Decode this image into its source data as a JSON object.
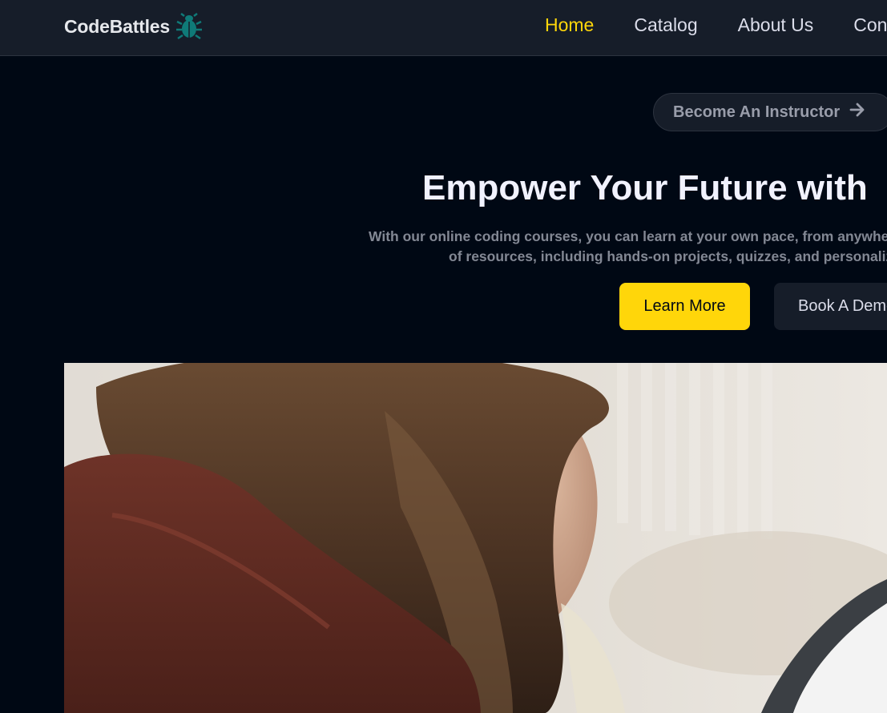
{
  "navbar": {
    "logo_text": "CodeBattles",
    "logo_icon": "bug-icon",
    "links": [
      {
        "label": "Home",
        "active": true
      },
      {
        "label": "Catalog",
        "active": false
      },
      {
        "label": "About Us",
        "active": false
      },
      {
        "label": "Cont",
        "active": false
      }
    ]
  },
  "hero": {
    "instructor_button": "Become An Instructor",
    "instructor_icon": "arrow-right-icon",
    "title": "Empower Your Future with",
    "subtitle_line1": "With our online coding courses, you can learn at your own pace, from anywhe",
    "subtitle_line2": "of resources, including hands-on projects, quizzes, and personaliz",
    "learn_more": "Learn More",
    "book_demo": "Book A Demo"
  },
  "colors": {
    "accent": "#ffd60a",
    "background": "#000814",
    "navbar": "#161d29",
    "logo_icon": "#0f7a78"
  }
}
